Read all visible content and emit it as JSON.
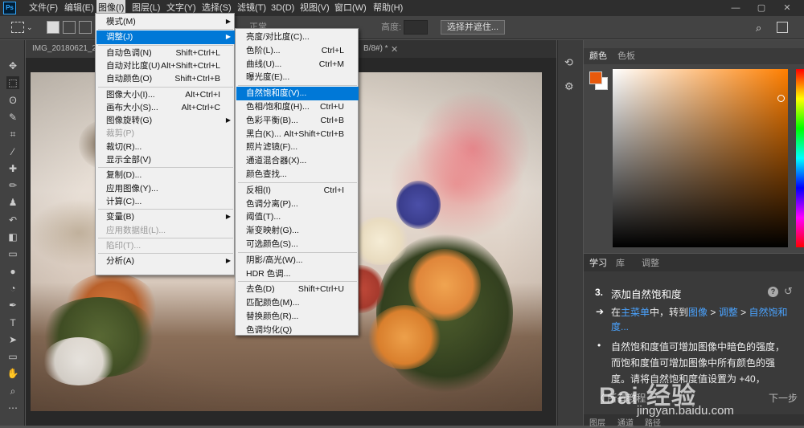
{
  "app": {
    "logo": "Ps"
  },
  "menubar": {
    "items": [
      "文件(F)",
      "编辑(E)",
      "图像(I)",
      "图层(L)",
      "文字(Y)",
      "选择(S)",
      "滤镜(T)",
      "3D(D)",
      "视图(V)",
      "窗口(W)",
      "帮助(H)"
    ],
    "active_index": 2,
    "window_controls": [
      "—",
      "▢",
      "✕"
    ]
  },
  "options": {
    "mode_label": "正常",
    "height_label": "高度:",
    "select_mask": "选择并遮住..."
  },
  "document": {
    "tab_name": "IMG_20180621_22",
    "tab2_suffix": "B/8#) *"
  },
  "image_menu": {
    "items": [
      {
        "label": "模式(M)",
        "shortcut": "",
        "submenu": true,
        "disabled": false,
        "highlight": false
      },
      {
        "sep": true
      },
      {
        "label": "调整(J)",
        "shortcut": "",
        "submenu": true,
        "disabled": false,
        "highlight": true
      },
      {
        "sep": true
      },
      {
        "label": "自动色调(N)",
        "shortcut": "Shift+Ctrl+L",
        "submenu": false,
        "disabled": false,
        "highlight": false
      },
      {
        "label": "自动对比度(U)",
        "shortcut": "Alt+Shift+Ctrl+L",
        "submenu": false,
        "disabled": false,
        "highlight": false
      },
      {
        "label": "自动颜色(O)",
        "shortcut": "Shift+Ctrl+B",
        "submenu": false,
        "disabled": false,
        "highlight": false
      },
      {
        "sep": true
      },
      {
        "label": "图像大小(I)...",
        "shortcut": "Alt+Ctrl+I",
        "submenu": false,
        "disabled": false,
        "highlight": false
      },
      {
        "label": "画布大小(S)...",
        "shortcut": "Alt+Ctrl+C",
        "submenu": false,
        "disabled": false,
        "highlight": false
      },
      {
        "label": "图像旋转(G)",
        "shortcut": "",
        "submenu": true,
        "disabled": false,
        "highlight": false
      },
      {
        "label": "裁剪(P)",
        "shortcut": "",
        "submenu": false,
        "disabled": true,
        "highlight": false
      },
      {
        "label": "裁切(R)...",
        "shortcut": "",
        "submenu": false,
        "disabled": false,
        "highlight": false
      },
      {
        "label": "显示全部(V)",
        "shortcut": "",
        "submenu": false,
        "disabled": false,
        "highlight": false
      },
      {
        "sep": true
      },
      {
        "label": "复制(D)...",
        "shortcut": "",
        "submenu": false,
        "disabled": false,
        "highlight": false
      },
      {
        "label": "应用图像(Y)...",
        "shortcut": "",
        "submenu": false,
        "disabled": false,
        "highlight": false
      },
      {
        "label": "计算(C)...",
        "shortcut": "",
        "submenu": false,
        "disabled": false,
        "highlight": false
      },
      {
        "sep": true
      },
      {
        "label": "变量(B)",
        "shortcut": "",
        "submenu": true,
        "disabled": false,
        "highlight": false
      },
      {
        "label": "应用数据组(L)...",
        "shortcut": "",
        "submenu": false,
        "disabled": true,
        "highlight": false
      },
      {
        "sep": true
      },
      {
        "label": "陷印(T)...",
        "shortcut": "",
        "submenu": false,
        "disabled": true,
        "highlight": false
      },
      {
        "sep": true
      },
      {
        "label": "分析(A)",
        "shortcut": "",
        "submenu": true,
        "disabled": false,
        "highlight": false
      }
    ]
  },
  "adjust_menu": {
    "items": [
      {
        "label": "亮度/对比度(C)...",
        "shortcut": "",
        "highlight": false
      },
      {
        "label": "色阶(L)...",
        "shortcut": "Ctrl+L",
        "highlight": false
      },
      {
        "label": "曲线(U)...",
        "shortcut": "Ctrl+M",
        "highlight": false
      },
      {
        "label": "曝光度(E)...",
        "shortcut": "",
        "highlight": false
      },
      {
        "sep": true
      },
      {
        "label": "自然饱和度(V)...",
        "shortcut": "",
        "highlight": true
      },
      {
        "label": "色相/饱和度(H)...",
        "shortcut": "Ctrl+U",
        "highlight": false
      },
      {
        "label": "色彩平衡(B)...",
        "shortcut": "Ctrl+B",
        "highlight": false
      },
      {
        "label": "黑白(K)...",
        "shortcut": "Alt+Shift+Ctrl+B",
        "highlight": false
      },
      {
        "label": "照片滤镜(F)...",
        "shortcut": "",
        "highlight": false
      },
      {
        "label": "通道混合器(X)...",
        "shortcut": "",
        "highlight": false
      },
      {
        "label": "颜色查找...",
        "shortcut": "",
        "highlight": false
      },
      {
        "sep": true
      },
      {
        "label": "反相(I)",
        "shortcut": "Ctrl+I",
        "highlight": false
      },
      {
        "label": "色调分离(P)...",
        "shortcut": "",
        "highlight": false
      },
      {
        "label": "阈值(T)...",
        "shortcut": "",
        "highlight": false
      },
      {
        "label": "渐变映射(G)...",
        "shortcut": "",
        "highlight": false
      },
      {
        "label": "可选颜色(S)...",
        "shortcut": "",
        "highlight": false
      },
      {
        "sep": true
      },
      {
        "label": "阴影/高光(W)...",
        "shortcut": "",
        "highlight": false
      },
      {
        "label": "HDR 色调...",
        "shortcut": "",
        "highlight": false
      },
      {
        "sep": true
      },
      {
        "label": "去色(D)",
        "shortcut": "Shift+Ctrl+U",
        "highlight": false
      },
      {
        "label": "匹配颜色(M)...",
        "shortcut": "",
        "highlight": false
      },
      {
        "label": "替换颜色(R)...",
        "shortcut": "",
        "highlight": false
      },
      {
        "label": "色调均化(Q)",
        "shortcut": "",
        "highlight": false
      }
    ]
  },
  "color_panel": {
    "tabs": [
      "颜色",
      "色板"
    ],
    "foreground": "#e8590c",
    "background": "#ffffff"
  },
  "learn_panel": {
    "tabs": [
      "学习",
      "库",
      "调整"
    ],
    "step_num": "3.",
    "step_title": "添加自然饱和度",
    "instr_prefix": "在",
    "instr_link1": "主菜单",
    "instr_mid": "中，转到",
    "instr_link2": "图像",
    "instr_sep1": " > ",
    "instr_link3": "调整",
    "instr_sep2": " > ",
    "instr_link4": "自然饱和度...",
    "bullet_line1": "自然饱和度值可增加图像中暗色的强度，",
    "bullet_line2": "而饱和度值可增加图像中所有颜色的强",
    "bullet_line3": "度。请将自然饱和度值设置为 +40，",
    "prev": "〈 所有教程",
    "next": "下一步",
    "bottom_tabs": [
      "图层",
      "通道",
      "路径"
    ]
  },
  "watermark": "jingyan.baidu.com",
  "watermark_brand": "Bai 经验"
}
